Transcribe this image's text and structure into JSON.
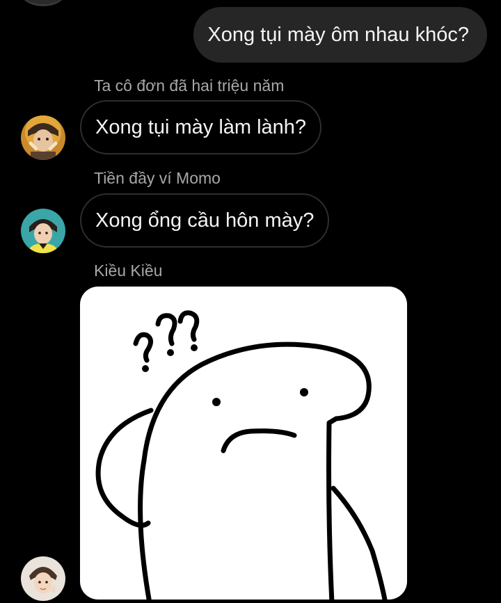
{
  "thread": {
    "outgoing_message": "Xong tụi mày ôm nhau khóc?",
    "messages": [
      {
        "sender": "Ta cô đơn đã hai triệu năm",
        "text": "Xong tụi mày làm lành?"
      },
      {
        "sender": "Tiền đầy ví Momo",
        "text": "Xong ổng cầu hôn mày?"
      },
      {
        "sender": "Kiều Kiều",
        "sticker": "confused-blob-question-marks"
      }
    ]
  },
  "colors": {
    "background": "#000000",
    "outgoing_bubble": "#262626",
    "incoming_border": "#2e2e2e",
    "sender_name": "#a8a8a8"
  }
}
